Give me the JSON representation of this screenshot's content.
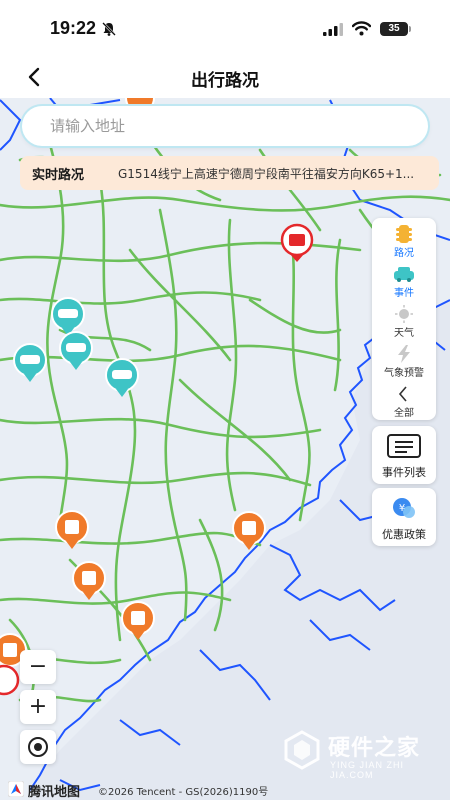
{
  "status_bar": {
    "time": "19:22",
    "battery": "35"
  },
  "header": {
    "title": "出行路况"
  },
  "search": {
    "placeholder": "请输入地址"
  },
  "traffic_banner": {
    "tag": "实时路况",
    "text": "G1514线宁上高速宁德周宁段南平往福安方向K65+1..."
  },
  "side_panel": {
    "items": [
      {
        "label": "路况",
        "icon": "traffic-light-icon",
        "active": true
      },
      {
        "label": "事件",
        "icon": "car-event-icon",
        "active": true
      },
      {
        "label": "天气",
        "icon": "sun-icon",
        "active": false
      },
      {
        "label": "气象预警",
        "icon": "lightning-icon",
        "active": false
      },
      {
        "label": "全部",
        "icon": "chevron-left-icon",
        "active": false
      }
    ]
  },
  "event_list": {
    "label": "事件列表",
    "icon": "list-icon"
  },
  "discount": {
    "label": "优惠政策",
    "icon": "discount-icon"
  },
  "zoom": {
    "out": "−",
    "in": "+"
  },
  "footer": {
    "brand": "腾讯地图",
    "copyright": "©2026 Tencent - GS(2026)1190号"
  },
  "watermark": {
    "title": "硬件之家",
    "subtitle": "YING JIAN ZHI JIA.COM"
  },
  "colors": {
    "road": "#6bbf59",
    "coast": "#1f55ff",
    "accent": "#1677ff",
    "banner": "#fde9d8",
    "construction": "#f07a2a",
    "accident": "#e4282b",
    "car_event": "#3ec4c6"
  }
}
